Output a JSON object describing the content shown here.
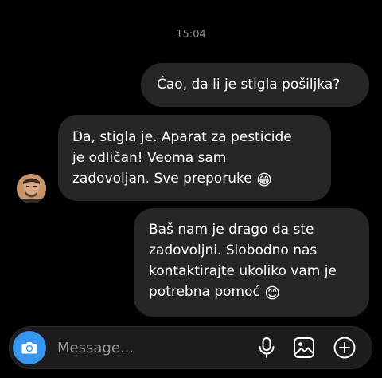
{
  "thread": {
    "timestamp": "15:04",
    "messages": [
      {
        "direction": "outgoing",
        "text": "Ćao, da li je stigla pošiljka?"
      },
      {
        "direction": "incoming",
        "lines": [
          "Da, stigla je. Aparat za pesticide",
          "je odličan! Veoma sam",
          "zadovoljan. Sve preporuke"
        ],
        "emoji": "😁"
      },
      {
        "direction": "outgoing",
        "lines": [
          "Baš nam je drago da ste",
          "zadovoljni. Slobodno nas",
          "kontaktirajte ukoliko vam je",
          "potrebna pomoć"
        ],
        "emoji": "😊"
      }
    ]
  },
  "composer": {
    "placeholder": "Message...",
    "value": ""
  },
  "icons": {
    "camera": "camera-icon",
    "microphone": "microphone-icon",
    "gallery": "gallery-icon",
    "plus": "plus-circle-icon"
  },
  "colors": {
    "background": "#000000",
    "bubble": "#262626",
    "accent": "#3797f0",
    "timestamp": "#8e8e93"
  }
}
